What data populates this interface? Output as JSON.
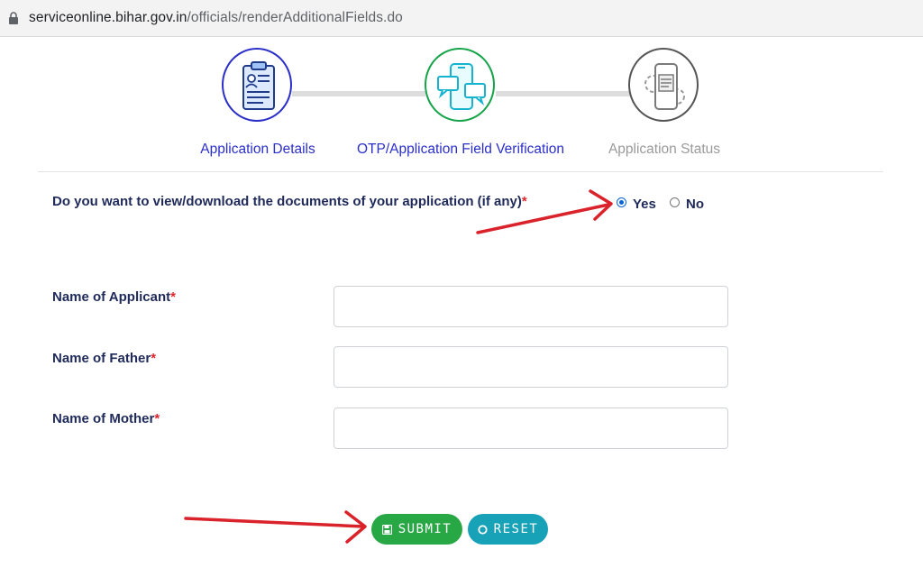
{
  "browser": {
    "url_host": "serviceonline.bihar.gov.in",
    "url_path": "/officials/renderAdditionalFields.do",
    "lock_icon": "lock-icon"
  },
  "stepper": {
    "steps": [
      {
        "label": "Application Details",
        "icon": "clipboard-form-icon",
        "color": "#2b2fc9",
        "state": "active"
      },
      {
        "label": "OTP/Application Field Verification",
        "icon": "phone-chat-icon",
        "color": "#16a34a",
        "state": "active"
      },
      {
        "label": "Application Status",
        "icon": "phone-gear-icon",
        "color": "#555555",
        "state": "inactive"
      }
    ]
  },
  "form": {
    "question": {
      "text": "Do you want to view/download the documents of your application (if any)",
      "required_mark": "*",
      "options": [
        {
          "label": "Yes",
          "selected": true
        },
        {
          "label": "No",
          "selected": false
        }
      ]
    },
    "fields": [
      {
        "label": "Name of Applicant",
        "required_mark": "*",
        "value": ""
      },
      {
        "label": "Name of Father",
        "required_mark": "*",
        "value": ""
      },
      {
        "label": "Name of Mother",
        "required_mark": "*",
        "value": ""
      }
    ],
    "buttons": {
      "submit": {
        "label": "SUBMIT",
        "icon": "floppy-disk-icon",
        "color": "#28a745"
      },
      "reset": {
        "label": "RESET",
        "icon": "refresh-circle-icon",
        "color": "#17a2b8"
      }
    }
  },
  "annotations": {
    "arrow_color": "#d9222a"
  },
  "colors": {
    "label_text": "#1f2a5a",
    "required": "#e0262c",
    "radio_accent": "#0a64d8"
  }
}
